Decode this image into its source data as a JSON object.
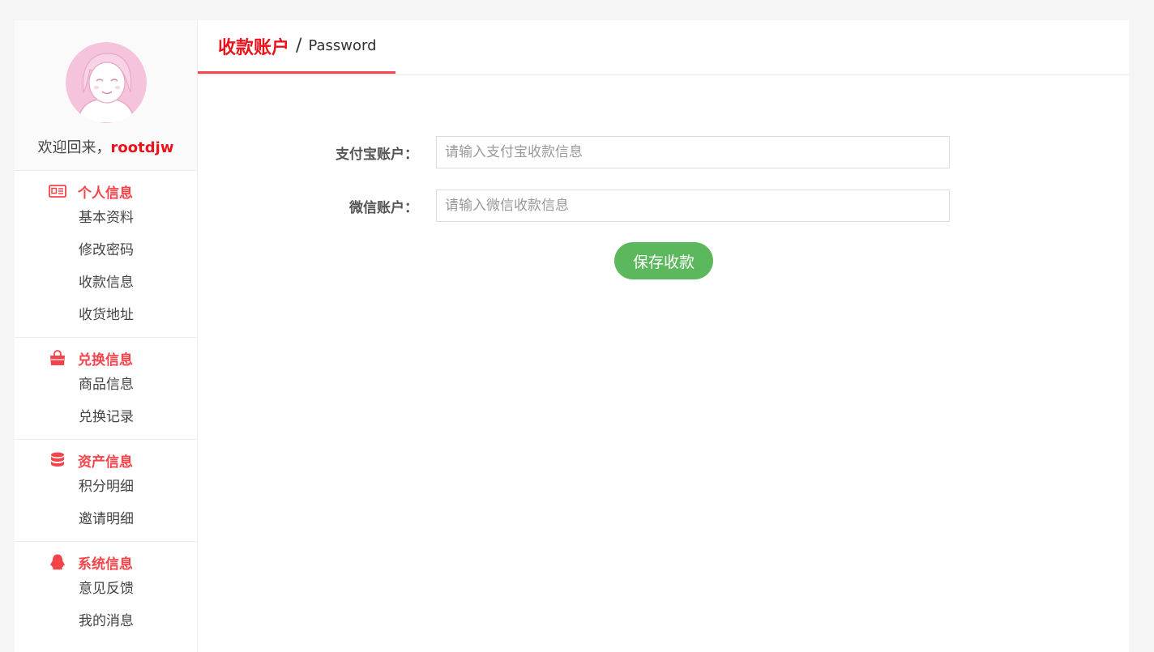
{
  "sidebar": {
    "welcome_prefix": "欢迎回来，",
    "username": "rootdjw",
    "groups": [
      {
        "title": "个人信息",
        "icon": "id-card-icon",
        "items": [
          "基本资料",
          "修改密码",
          "收款信息",
          "收货地址"
        ]
      },
      {
        "title": "兑换信息",
        "icon": "shopping-bag-icon",
        "items": [
          "商品信息",
          "兑换记录"
        ]
      },
      {
        "title": "资产信息",
        "icon": "database-icon",
        "items": [
          "积分明细",
          "邀请明细"
        ]
      },
      {
        "title": "系统信息",
        "icon": "qq-penguin-icon",
        "items": [
          "意见反馈",
          "我的消息"
        ]
      }
    ]
  },
  "tab": {
    "title_cn": "收款账户",
    "separator": "/",
    "title_en": "Password"
  },
  "form": {
    "alipay_label": "支付宝账户：",
    "alipay_placeholder": "请输入支付宝收款信息",
    "wechat_label": "微信账户：",
    "wechat_placeholder": "请输入微信收款信息",
    "save_label": "保存收款"
  },
  "colors": {
    "accent_red": "#f2444a",
    "username_red": "#e8141c",
    "save_green": "#5cb85c"
  }
}
